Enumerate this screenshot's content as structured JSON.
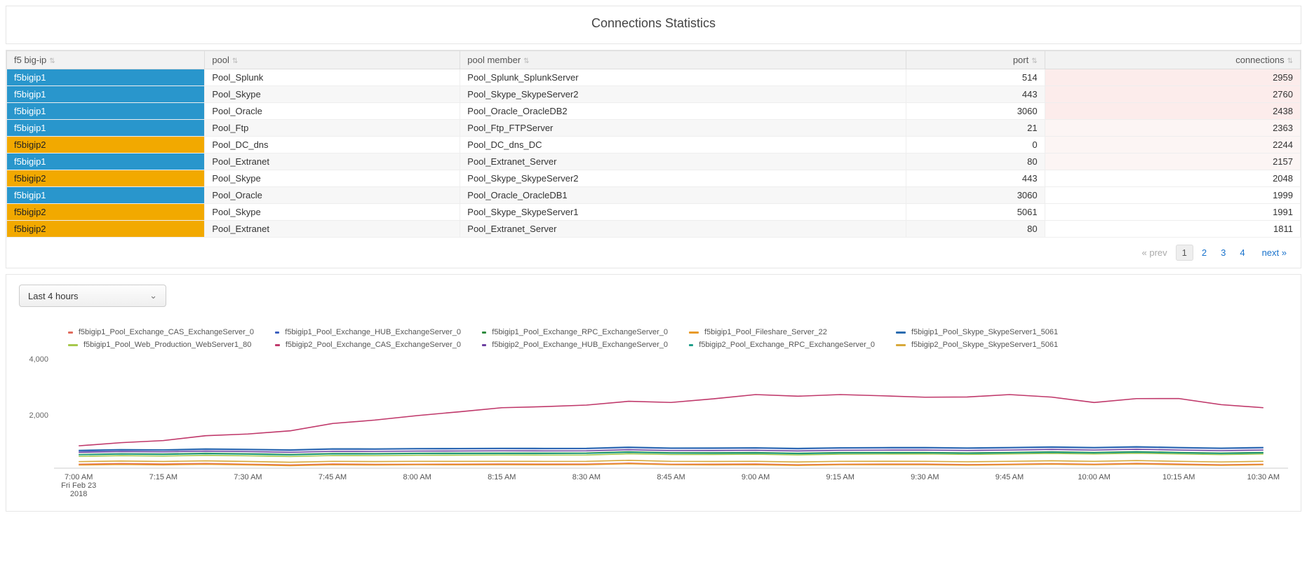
{
  "title": "Connections Statistics",
  "columns": [
    {
      "label": "f5 big-ip",
      "align": "left"
    },
    {
      "label": "pool",
      "align": "left"
    },
    {
      "label": "pool member",
      "align": "left"
    },
    {
      "label": "port",
      "align": "right"
    },
    {
      "label": "connections",
      "align": "right"
    }
  ],
  "rows": [
    {
      "host": "f5bigip1",
      "host_color": "blue",
      "pool": "Pool_Splunk",
      "member": "Pool_Splunk_SplunkServer",
      "port": 514,
      "connections": 2959,
      "conn_class": "conn-warn"
    },
    {
      "host": "f5bigip1",
      "host_color": "blue",
      "pool": "Pool_Skype",
      "member": "Pool_Skype_SkypeServer2",
      "port": 443,
      "connections": 2760,
      "conn_class": "conn-warn"
    },
    {
      "host": "f5bigip1",
      "host_color": "blue",
      "pool": "Pool_Oracle",
      "member": "Pool_Oracle_OracleDB2",
      "port": 3060,
      "connections": 2438,
      "conn_class": "conn-warn"
    },
    {
      "host": "f5bigip1",
      "host_color": "blue",
      "pool": "Pool_Ftp",
      "member": "Pool_Ftp_FTPServer",
      "port": 21,
      "connections": 2363,
      "conn_class": "conn-soft"
    },
    {
      "host": "f5bigip2",
      "host_color": "orange",
      "pool": "Pool_DC_dns",
      "member": "Pool_DC_dns_DC",
      "port": 0,
      "connections": 2244,
      "conn_class": "conn-soft"
    },
    {
      "host": "f5bigip1",
      "host_color": "blue",
      "pool": "Pool_Extranet",
      "member": "Pool_Extranet_Server",
      "port": 80,
      "connections": 2157,
      "conn_class": "conn-soft"
    },
    {
      "host": "f5bigip2",
      "host_color": "orange",
      "pool": "Pool_Skype",
      "member": "Pool_Skype_SkypeServer2",
      "port": 443,
      "connections": 2048,
      "conn_class": ""
    },
    {
      "host": "f5bigip1",
      "host_color": "blue",
      "pool": "Pool_Oracle",
      "member": "Pool_Oracle_OracleDB1",
      "port": 3060,
      "connections": 1999,
      "conn_class": ""
    },
    {
      "host": "f5bigip2",
      "host_color": "orange",
      "pool": "Pool_Skype",
      "member": "Pool_Skype_SkypeServer1",
      "port": 5061,
      "connections": 1991,
      "conn_class": ""
    },
    {
      "host": "f5bigip2",
      "host_color": "orange",
      "pool": "Pool_Extranet",
      "member": "Pool_Extranet_Server",
      "port": 80,
      "connections": 1811,
      "conn_class": ""
    }
  ],
  "pager": {
    "prev": "« prev",
    "pages": [
      "1",
      "2",
      "3",
      "4"
    ],
    "current": 1,
    "next": "next »"
  },
  "time_range_label": "Last 4 hours",
  "chart_data": {
    "type": "line",
    "ylim": [
      0,
      4000
    ],
    "yticks": [
      2000,
      4000
    ],
    "date_caption": "Fri Feb 23\n2018",
    "x": [
      "7:00 AM",
      "7:15 AM",
      "7:30 AM",
      "7:45 AM",
      "8:00 AM",
      "8:15 AM",
      "8:30 AM",
      "8:45 AM",
      "9:00 AM",
      "9:15 AM",
      "9:30 AM",
      "9:45 AM",
      "10:00 AM",
      "10:15 AM",
      "10:30 AM"
    ],
    "series": [
      {
        "name": "f5bigip1_Pool_Exchange_CAS_ExchangeServer_0",
        "color": "#e06b5d",
        "values": [
          150,
          160,
          150,
          160,
          150,
          160,
          155,
          150,
          160,
          150,
          155,
          150,
          150,
          155,
          150
        ]
      },
      {
        "name": "f5bigip1_Pool_Exchange_HUB_ExchangeServer_0",
        "color": "#3b5fbf",
        "values": [
          650,
          680,
          700,
          720,
          730,
          740,
          740,
          750,
          760,
          760,
          770,
          770,
          770,
          770,
          770
        ]
      },
      {
        "name": "f5bigip1_Pool_Exchange_RPC_ExchangeServer_0",
        "color": "#2e8b3e",
        "values": [
          520,
          540,
          550,
          560,
          570,
          575,
          580,
          590,
          595,
          595,
          600,
          600,
          600,
          600,
          600
        ]
      },
      {
        "name": "f5bigip1_Pool_Fileshare_Server_22",
        "color": "#e89a2a",
        "values": [
          120,
          125,
          125,
          130,
          130,
          130,
          130,
          130,
          130,
          130,
          130,
          130,
          130,
          130,
          130
        ]
      },
      {
        "name": "f5bigip1_Pool_Skype_SkypeServer1_5061",
        "color": "#2b6cb0",
        "values": [
          680,
          700,
          720,
          740,
          750,
          760,
          760,
          770,
          780,
          780,
          790,
          790,
          790,
          790,
          790
        ]
      },
      {
        "name": "f5bigip1_Pool_Web_Production_WebServer1_80",
        "color": "#a6c84c",
        "values": [
          450,
          460,
          470,
          480,
          490,
          500,
          500,
          520,
          530,
          530,
          540,
          540,
          540,
          540,
          540
        ]
      },
      {
        "name": "f5bigip2_Pool_Exchange_CAS_ExchangeServer_0",
        "color": "#c0396b",
        "values": [
          850,
          1050,
          1300,
          1700,
          2000,
          2300,
          2400,
          2500,
          2800,
          2800,
          2700,
          2800,
          2500,
          2650,
          2300
        ]
      },
      {
        "name": "f5bigip2_Pool_Exchange_HUB_ExchangeServer_0",
        "color": "#6b3fa0",
        "values": [
          600,
          620,
          630,
          640,
          650,
          660,
          660,
          670,
          680,
          680,
          690,
          690,
          690,
          690,
          690
        ]
      },
      {
        "name": "f5bigip2_Pool_Exchange_RPC_ExchangeServer_0",
        "color": "#1f9e8a",
        "values": [
          510,
          520,
          530,
          540,
          550,
          555,
          560,
          570,
          575,
          575,
          580,
          580,
          580,
          580,
          580
        ]
      },
      {
        "name": "f5bigip2_Pool_Skype_SkypeServer1_5061",
        "color": "#d8a93a",
        "values": [
          250,
          255,
          255,
          260,
          260,
          260,
          260,
          260,
          260,
          260,
          260,
          260,
          260,
          260,
          260
        ]
      }
    ]
  }
}
